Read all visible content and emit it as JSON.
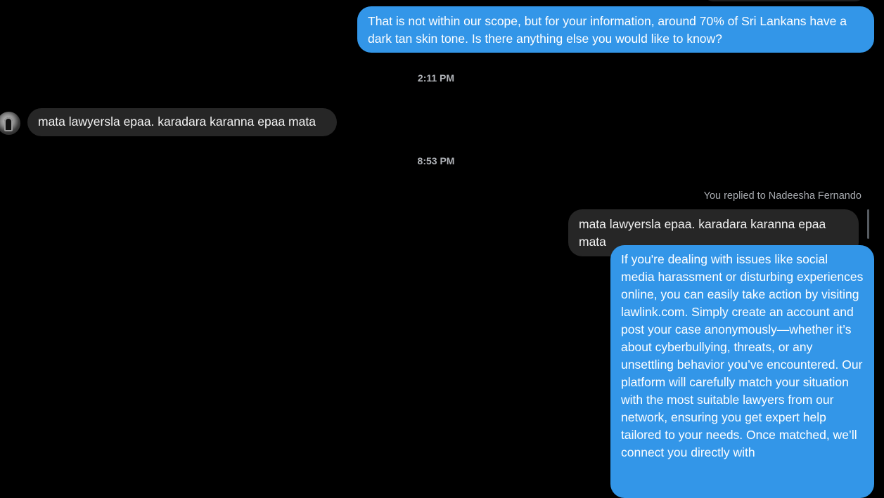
{
  "colors": {
    "background": "#000000",
    "outgoing_bubble": "#3396e8",
    "incoming_bubble": "#262626",
    "timestamp_text": "#b0b3b8"
  },
  "messages": [
    {
      "direction": "outgoing",
      "text": "That is not within our scope, but for your information, around 70% of Sri Lankans have a dark tan skin tone. Is there anything else you would like to know?"
    },
    {
      "direction": "incoming",
      "text": "mata lawyersla epaa. karadara karanna epaa mata"
    },
    {
      "direction": "outgoing",
      "quoted": true,
      "text": "mata lawyersla epaa. karadara karanna epaa mata"
    },
    {
      "direction": "outgoing",
      "text": "If you're dealing with issues like social media harassment or disturbing experiences online, you can easily take action by visiting lawlink.com. Simply create an account and post your case anonymously—whether it’s about cyberbullying, threats, or any unsettling behavior you’ve encountered. Our platform will carefully match your situation with the most suitable lawyers from our network, ensuring you get expert help tailored to your needs. Once matched, we’ll connect you directly with"
    }
  ],
  "timestamps": [
    "2:11 PM",
    "8:53 PM"
  ],
  "reply_label": "You replied to Nadeesha Fernando",
  "avatar_icon": "user-avatar"
}
